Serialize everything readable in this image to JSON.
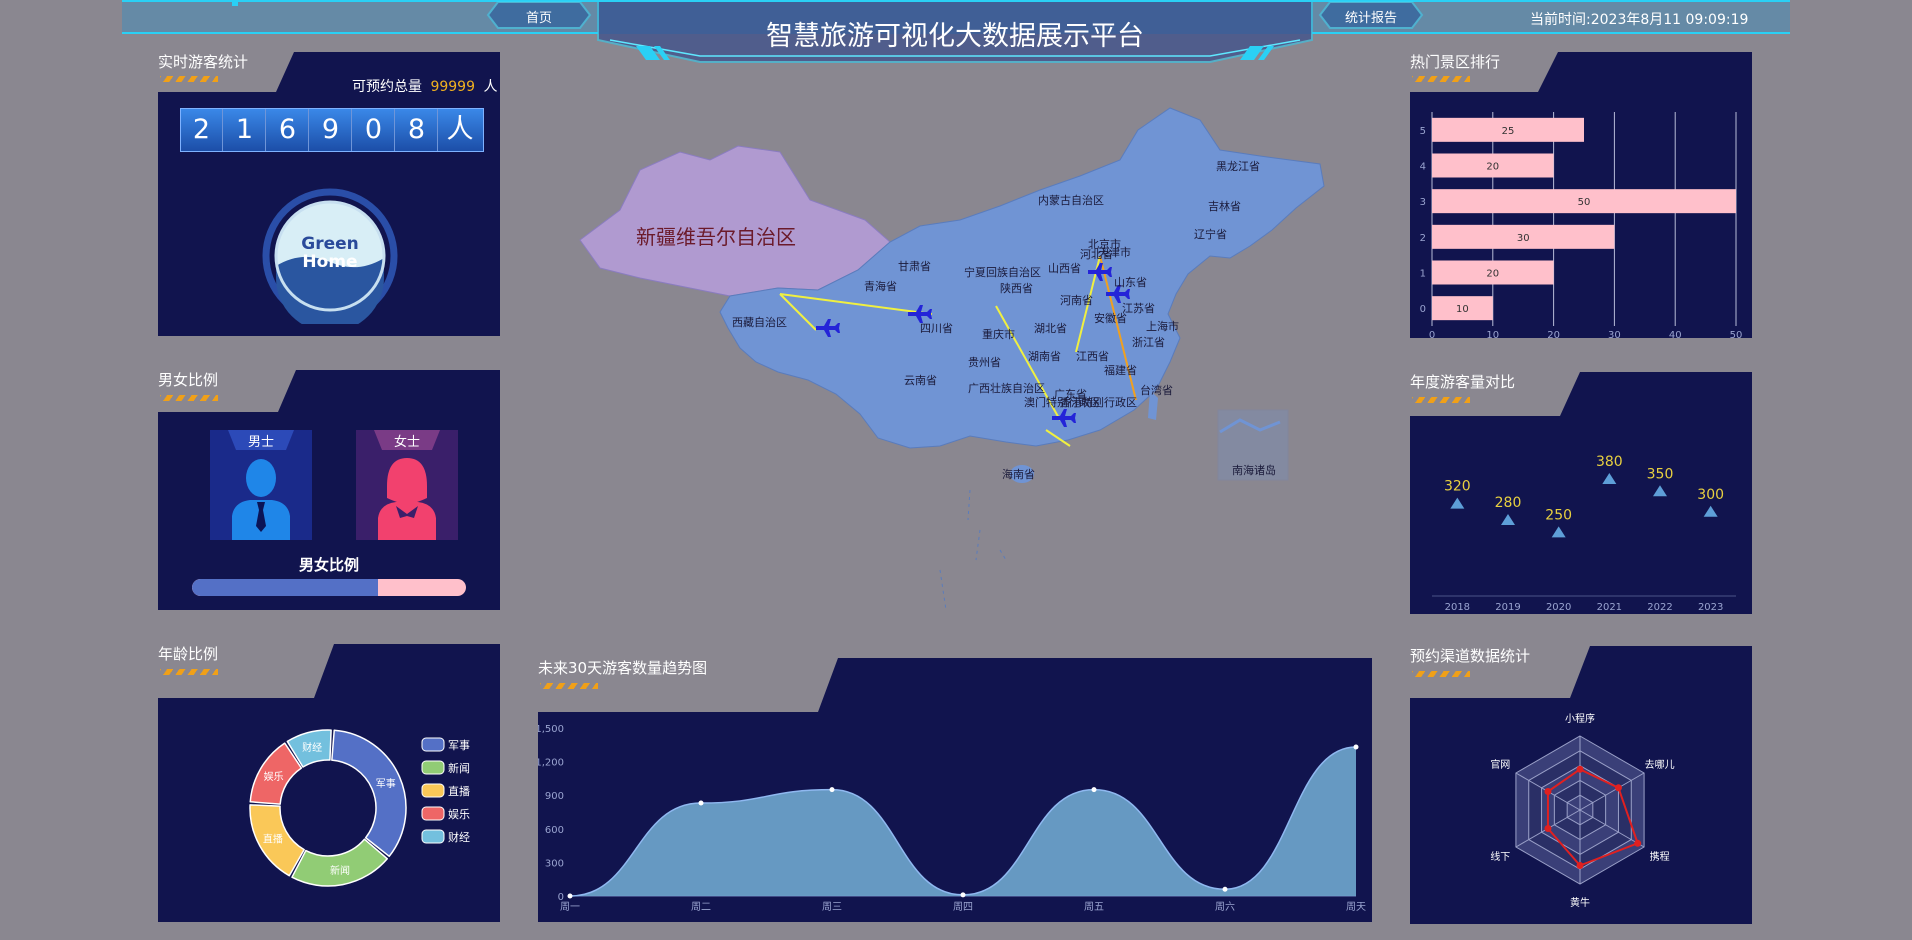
{
  "header": {
    "title": "智慧旅游可视化大数据展示平台",
    "home_label": "首页",
    "report_label": "统计报告",
    "time_prefix": "当前时间:",
    "time_value": "2023年8月11 09:09:19"
  },
  "visitors": {
    "title": "实时游客统计",
    "total_label": "可预约总量",
    "total_value": "99999",
    "total_unit": "人",
    "digits": [
      "2",
      "1",
      "6",
      "9",
      "0",
      "8",
      "人"
    ],
    "logo_line1": "Green",
    "logo_line2": "Home"
  },
  "gender": {
    "title": "男女比例",
    "male_label": "男士",
    "female_label": "女士",
    "ratio_label": "男女比例",
    "male_ratio": 0.68
  },
  "age": {
    "title": "年龄比例",
    "chart_data": {
      "type": "pie",
      "slices": [
        {
          "name": "军事",
          "value": 35,
          "color": "#5470c6"
        },
        {
          "name": "新闻",
          "value": 22,
          "color": "#91cc75"
        },
        {
          "name": "直播",
          "value": 18,
          "color": "#fac858"
        },
        {
          "name": "娱乐",
          "value": 15,
          "color": "#ee6666"
        },
        {
          "name": "财经",
          "value": 10,
          "color": "#73c0de"
        }
      ]
    }
  },
  "map": {
    "highlight_region": "新疆维吾尔自治区",
    "provinces": [
      "内蒙古自治区",
      "黑龙江省",
      "吉林省",
      "辽宁省",
      "北京市",
      "天津市",
      "河北省",
      "山东省",
      "甘肃省",
      "宁夏回族自治区",
      "山西省",
      "青海省",
      "陕西省",
      "河南省",
      "西藏自治区",
      "四川省",
      "重庆市",
      "湖北省",
      "安徽省",
      "江苏省",
      "上海市",
      "浙江省",
      "贵州省",
      "湖南省",
      "江西省",
      "云南省",
      "广西壮族自治区",
      "广东省",
      "福建省",
      "台湾省",
      "香港特别行政区",
      "澳门特别行政区",
      "海南省"
    ],
    "inset_label": "南海诸岛"
  },
  "trend": {
    "title": "未来30天游客数量趋势图",
    "chart_data": {
      "type": "area",
      "categories": [
        "周一",
        "周二",
        "周三",
        "周四",
        "周五",
        "周六",
        "周天"
      ],
      "values": [
        0,
        830,
        950,
        10,
        950,
        60,
        1330
      ],
      "ylim": [
        0,
        1500
      ],
      "yticks": [
        "0",
        "300",
        "600",
        "900",
        "1,200",
        "1,500"
      ],
      "color": "#6ba0c8"
    }
  },
  "hot": {
    "title": "热门景区排行",
    "chart_data": {
      "type": "bar",
      "orientation": "horizontal",
      "categories": [
        "0",
        "1",
        "2",
        "3",
        "4",
        "5"
      ],
      "values": [
        10,
        20,
        30,
        50,
        20,
        25
      ],
      "xlim": [
        0,
        50
      ],
      "xticks": [
        "0",
        "10",
        "20",
        "30",
        "40",
        "50"
      ],
      "color": "#ffc0cb"
    }
  },
  "annual": {
    "title": "年度游客量对比",
    "chart_data": {
      "type": "scatter",
      "categories": [
        "2018",
        "2019",
        "2020",
        "2021",
        "2022",
        "2023"
      ],
      "values": [
        320,
        280,
        250,
        380,
        350,
        300
      ],
      "label_color": "#e8d040",
      "marker_color": "#5e9fd8"
    }
  },
  "channel": {
    "title": "预约渠道数据统计",
    "chart_data": {
      "type": "radar",
      "indicators": [
        "小程序",
        "去哪儿",
        "携程",
        "黄牛",
        "线下",
        "官网"
      ],
      "values": [
        0.55,
        0.6,
        0.9,
        0.75,
        0.5,
        0.5
      ],
      "color": "#e02020"
    }
  }
}
